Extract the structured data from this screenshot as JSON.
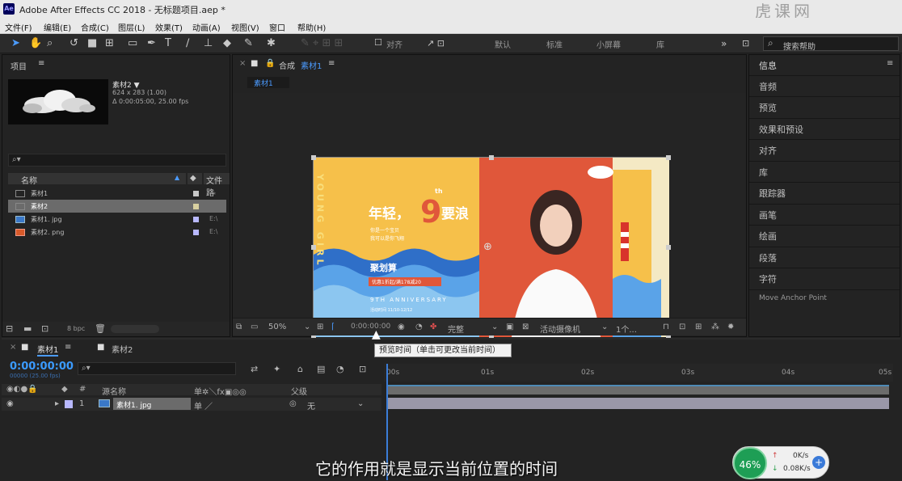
{
  "window": {
    "title": "Adobe After Effects CC 2018 - 无标题项目.aep *",
    "logo": "Ae",
    "watermark": "虎课网"
  },
  "menu": [
    "文件(F)",
    "编辑(E)",
    "合成(C)",
    "图层(L)",
    "效果(T)",
    "动画(A)",
    "视图(V)",
    "窗口",
    "帮助(H)"
  ],
  "toolbar": {
    "snap_label": "对齐",
    "workspaces": [
      "默认",
      "标准",
      "小屏幕",
      "库"
    ],
    "search_placeholder": "搜索帮助"
  },
  "project": {
    "panel_title": "项目",
    "selected": {
      "name": "素材2 ▼",
      "dims": "624 x 283 (1.00)",
      "duration": "Δ 0:00:05:00, 25.00 fps"
    },
    "col_name": "名称",
    "col_file": "文件路",
    "items": [
      {
        "name": "素材1",
        "icon": "composition-icon",
        "color": "#c8c8c8",
        "extra": "⁂"
      },
      {
        "name": "素材2",
        "icon": "composition-icon",
        "color": "#d8d0a0",
        "extra": ""
      },
      {
        "name": "素材1. jpg",
        "icon": "image-icon",
        "color": "#b8b8ff",
        "extra": "E:\\"
      },
      {
        "name": "素材2. png",
        "icon": "image-icon",
        "color": "#b8b8ff",
        "extra": "E:\\"
      }
    ],
    "bpc": "8 bpc"
  },
  "composition": {
    "tab_label": "合成",
    "tab_name": "素材1",
    "sub_tab": "素材1",
    "zoom": "50%",
    "time": "0:00:00:00",
    "resolution": "完整",
    "camera": "活动摄像机",
    "views": "1个..."
  },
  "banner": {
    "vertical_text": "YOUNG GIRL",
    "headline_a": "年轻，",
    "big_num": "9",
    "sup": "th",
    "headline_b": "要浪",
    "small1": "你是一个宝贝",
    "small2": "我可以是你飞翔",
    "brand": "聚划算",
    "promo": "优惠1折起/满178减20",
    "anniv": "9TH ANNIVERSARY",
    "footer": "活动时间 11/10-12/12"
  },
  "right_panel": {
    "items": [
      "信息",
      "音频",
      "预览",
      "效果和预设",
      "对齐",
      "库",
      "跟踪器",
      "画笔",
      "绘画",
      "段落",
      "字符",
      "Move Anchor Point"
    ]
  },
  "timeline": {
    "tab_active": "素材1",
    "tab_other": "素材2",
    "timecode": "0:00:00:00",
    "timecode_sub": "00000 (25.00 fps)",
    "ticks": [
      "00s",
      "01s",
      "02s",
      "03s",
      "04s",
      "05s"
    ],
    "col_source": "源名称",
    "col_parent": "父级",
    "layer": {
      "num": "1",
      "name": "素材1. jpg",
      "parent": "无"
    }
  },
  "tooltip": "预览时间（单击可更改当前时间）",
  "subtitle": "它的作用就是显示当前位置的时间",
  "network": {
    "percent": "46%",
    "up": "0K/s",
    "down": "0.08K/s"
  }
}
